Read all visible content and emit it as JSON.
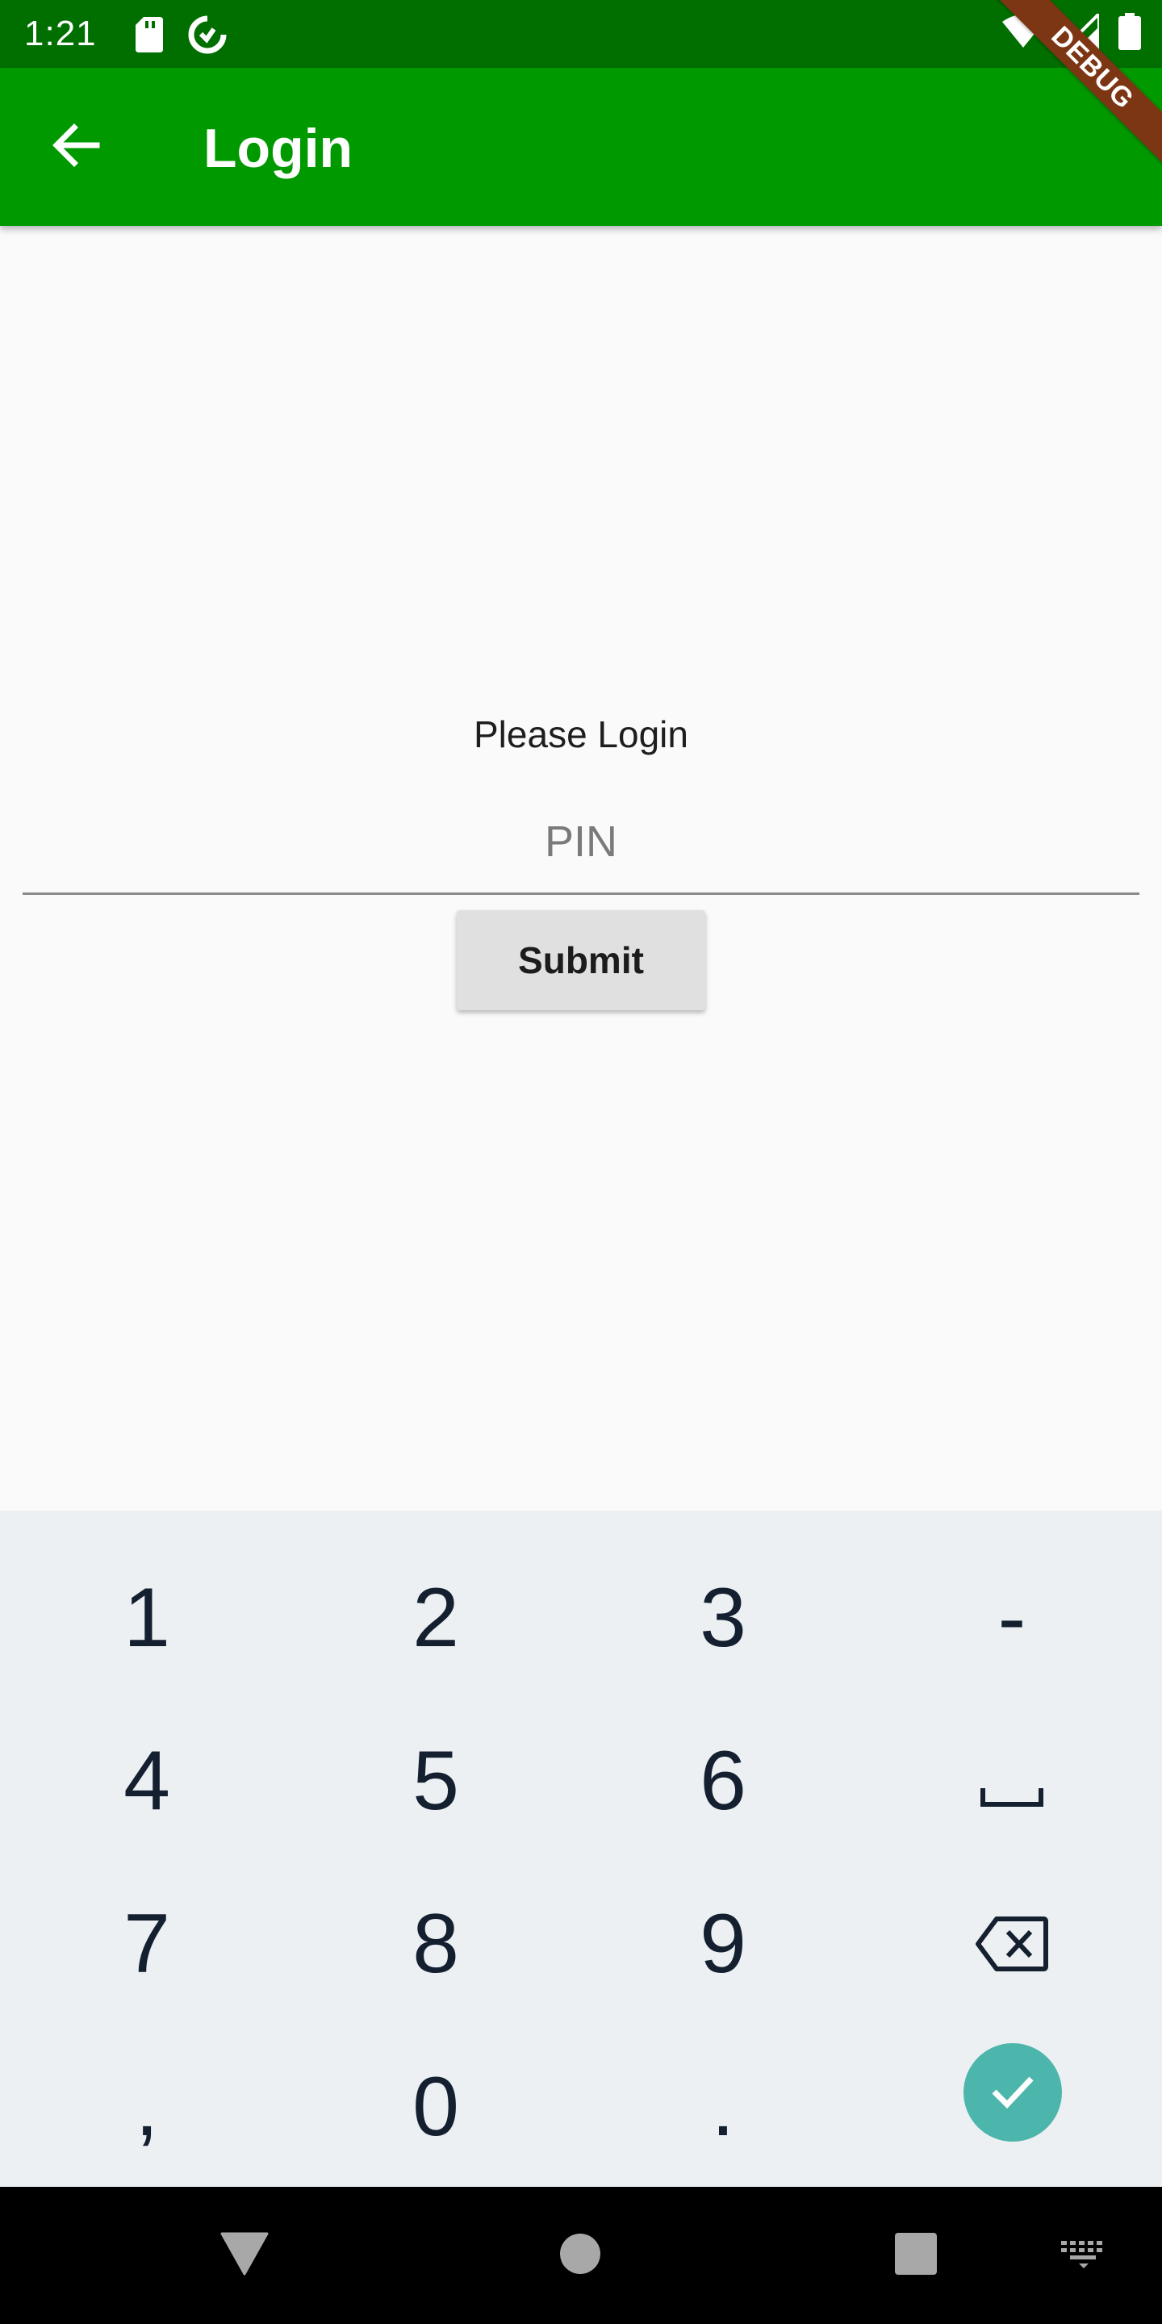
{
  "status_bar": {
    "time": "1:21",
    "icons": [
      "sd-card-icon",
      "data-saver-icon",
      "wifi-icon",
      "signal-icon",
      "battery-icon"
    ]
  },
  "app_bar": {
    "title": "Login",
    "back_icon": "arrow-back-icon",
    "background_color": "#009900"
  },
  "debug_banner": {
    "label": "DEBUG"
  },
  "form": {
    "prompt": "Please Login",
    "pin_placeholder": "PIN",
    "submit_label": "Submit"
  },
  "keyboard": {
    "rows": [
      [
        "1",
        "2",
        "3",
        "-"
      ],
      [
        "4",
        "5",
        "6",
        "space-icon"
      ],
      [
        "7",
        "8",
        "9",
        "backspace-icon"
      ],
      [
        ",",
        "0",
        ".",
        "done-icon"
      ]
    ],
    "accent_color": "#4db6ac"
  },
  "nav_bar": {
    "icons": [
      "back-triangle-icon",
      "home-circle-icon",
      "recents-square-icon",
      "keyboard-switch-icon"
    ]
  }
}
